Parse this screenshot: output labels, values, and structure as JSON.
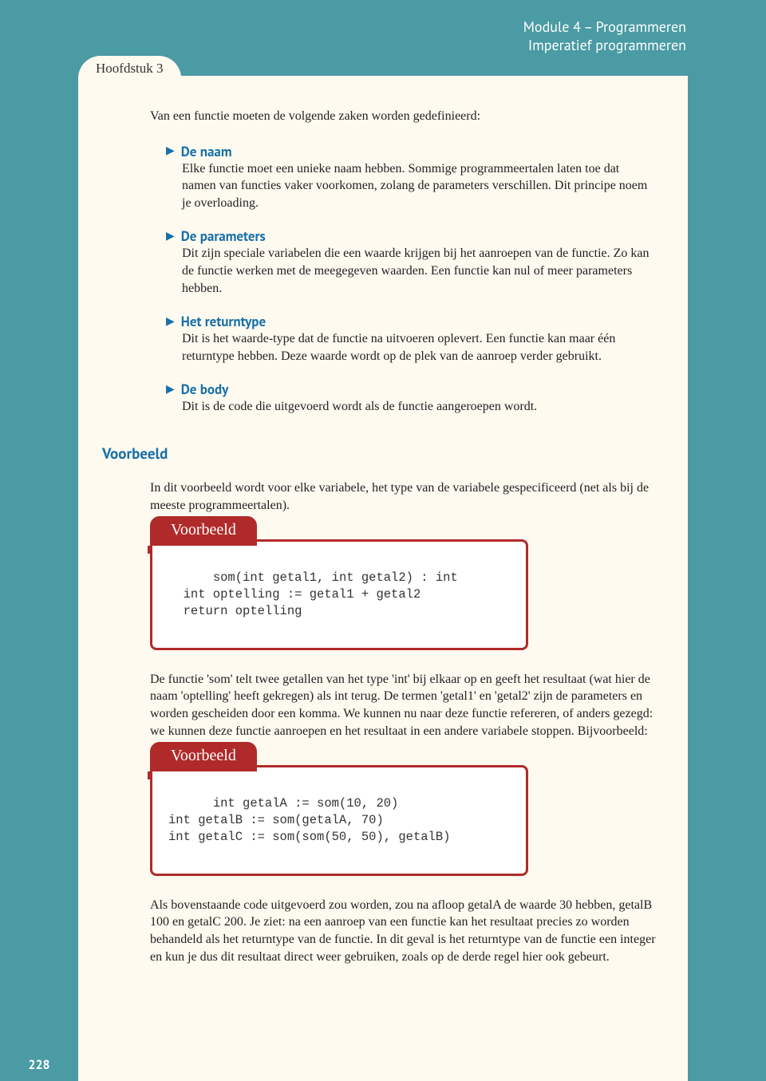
{
  "header": {
    "module_line": "Module 4 – Programmeren",
    "topic_line": "Imperatief programmeren"
  },
  "chapter_tab": "Hoofdstuk 3",
  "intro": "Van een functie moeten de volgende zaken worden gedefinieerd:",
  "defs": [
    {
      "title": "De naam",
      "body": "Elke functie moet een unieke naam hebben. Sommige programmeertalen laten toe dat namen van functies vaker voorkomen, zolang de parameters verschillen. Dit principe noem je overloading."
    },
    {
      "title": "De parameters",
      "body": "Dit zijn speciale variabelen die een waarde krijgen bij het aanroepen van de functie. Zo kan de functie werken met de meegegeven waarden. Een functie kan nul of meer parameters hebben."
    },
    {
      "title": "Het returntype",
      "body": "Dit is het waarde-type dat de functie na uitvoeren oplevert. Een functie kan maar één returntype hebben. Deze waarde wordt op de plek van de aanroep verder gebruikt."
    },
    {
      "title": "De body",
      "body": "Dit is de code die uitgevoerd wordt als de functie aangeroepen wordt."
    }
  ],
  "example_section_title": "Voorbeeld",
  "example_intro": "In dit voorbeeld wordt voor elke variabele, het type van de variabele gespecificeerd (net als bij de meeste programmeertalen).",
  "example1": {
    "tab": "Voorbeeld",
    "code": "som(int getal1, int getal2) : int\n  int optelling := getal1 + getal2\n  return optelling"
  },
  "para_after_ex1": "De functie 'som' telt twee getallen van het type 'int' bij elkaar op en geeft het resultaat (wat hier de naam 'optelling' heeft gekregen) als int terug. De termen 'getal1' en 'getal2' zijn de parameters en worden gescheiden door een komma. We kunnen nu naar deze functie refereren, of anders gezegd: we kunnen deze functie aanroepen en het resultaat in een andere variabele stoppen. Bijvoorbeeld:",
  "example2": {
    "tab": "Voorbeeld",
    "code": "int getalA := som(10, 20)\nint getalB := som(getalA, 70)\nint getalC := som(som(50, 50), getalB)"
  },
  "para_after_ex2": "Als bovenstaande code uitgevoerd zou worden, zou na afloop getalA de waarde 30 hebben, getalB 100 en getalC 200. Je ziet: na een aanroep van een functie kan het resultaat precies zo worden behandeld als het returntype van de functie. In dit geval is het returntype van de functie een integer en kun je dus dit resultaat direct weer gebruiken, zoals op de derde regel hier ook gebeurt.",
  "page_number": "228"
}
